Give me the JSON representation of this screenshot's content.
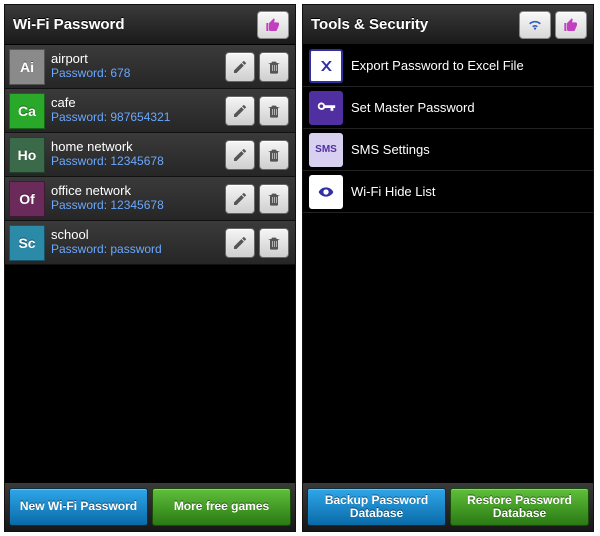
{
  "left": {
    "title": "Wi-Fi Password",
    "items": [
      {
        "badge": "Ai",
        "color": "#8a8a8a",
        "name": "airport",
        "pw": "Password: 678"
      },
      {
        "badge": "Ca",
        "color": "#2aa82a",
        "name": "cafe",
        "pw": "Password: 987654321"
      },
      {
        "badge": "Ho",
        "color": "#3a6a4a",
        "name": "home network",
        "pw": "Password: 12345678"
      },
      {
        "badge": "Of",
        "color": "#6a2a5a",
        "name": "office network",
        "pw": "Password: 12345678"
      },
      {
        "badge": "Sc",
        "color": "#2a8aa8",
        "name": "school",
        "pw": "Password: password"
      }
    ],
    "bottom": {
      "new": "New Wi-Fi Password",
      "games": "More free games"
    }
  },
  "right": {
    "title": "Tools & Security",
    "items": [
      {
        "label": "Export Password to Excel File"
      },
      {
        "label": "Set Master Password"
      },
      {
        "label": "SMS Settings"
      },
      {
        "label": "Wi-Fi Hide List"
      }
    ],
    "bottom": {
      "backup": "Backup Password Database",
      "restore": "Restore Password Database"
    }
  }
}
